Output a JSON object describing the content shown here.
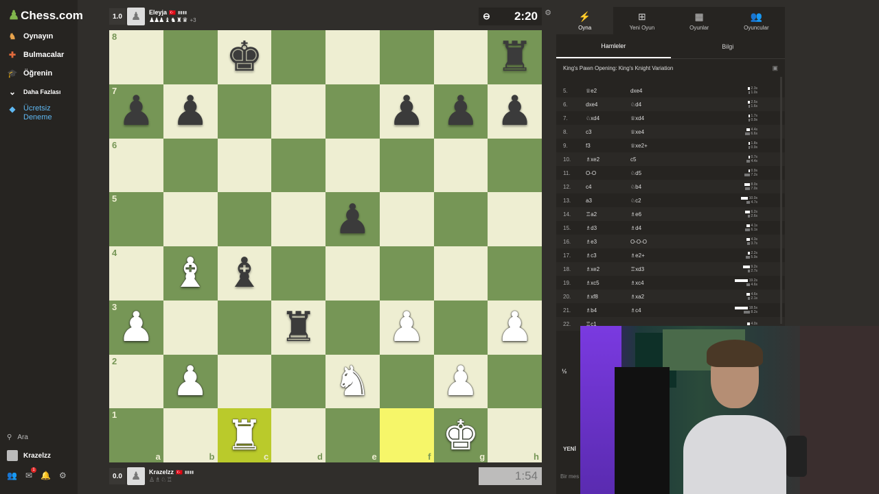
{
  "sidebar": {
    "logo": "Chess.com",
    "items": [
      {
        "label": "Oynayın",
        "icon": "play-icon"
      },
      {
        "label": "Bulmacalar",
        "icon": "puzzle-icon"
      },
      {
        "label": "Öğrenin",
        "icon": "learn-icon"
      },
      {
        "label": "Daha Fazlası",
        "icon": "chevron-down-icon"
      },
      {
        "label": "Ücretsiz Deneme",
        "icon": "diamond-icon"
      }
    ],
    "search": "Ara",
    "user": "Krazelzz",
    "notif_count": "1"
  },
  "top_player": {
    "rating": "1.0",
    "name": "Eleyja",
    "flag": "🇹🇷",
    "captured": "♟♟♟ ♝ ♞ ♜ ♛",
    "material": "+3",
    "clock": "2:20"
  },
  "bottom_player": {
    "rating": "0.0",
    "name": "Krazelzz",
    "flag": "🇹🇷",
    "captured": "♙ ♗ ♘ ♖",
    "clock": "1:54"
  },
  "board": {
    "files": [
      "a",
      "b",
      "c",
      "d",
      "e",
      "f",
      "g",
      "h"
    ],
    "ranks": [
      "8",
      "7",
      "6",
      "5",
      "4",
      "3",
      "2",
      "1"
    ],
    "position": [
      [
        "",
        "",
        "bK",
        "",
        "",
        "",
        "",
        "bR"
      ],
      [
        "bP",
        "bP",
        "",
        "",
        "",
        "bP",
        "bP",
        "bP"
      ],
      [
        "",
        "",
        "",
        "",
        "",
        "",
        "",
        ""
      ],
      [
        "",
        "",
        "",
        "",
        "bP",
        "",
        "",
        ""
      ],
      [
        "",
        "wB",
        "bB",
        "",
        "",
        "",
        "",
        ""
      ],
      [
        "wP",
        "",
        "",
        "bR",
        "",
        "wP",
        "",
        "wP"
      ],
      [
        "",
        "wP",
        "",
        "",
        "wN",
        "",
        "wP",
        ""
      ],
      [
        "",
        "",
        "wR",
        "",
        "",
        "",
        "wK",
        ""
      ]
    ],
    "highlight": [
      "c1",
      "f1"
    ]
  },
  "panel": {
    "tabs": [
      {
        "label": "Oyna",
        "icon": "lightning-icon"
      },
      {
        "label": "Yeni Oyun",
        "icon": "plus-square-icon"
      },
      {
        "label": "Oyunlar",
        "icon": "board-icon"
      },
      {
        "label": "Oyuncular",
        "icon": "players-icon"
      }
    ],
    "subtabs": [
      "Hamleler",
      "Bilgi"
    ],
    "opening": "King's Pawn Opening: King's Knight Variation",
    "moves": [
      {
        "n": "5.",
        "w": "♕e2",
        "b": "dxe4",
        "tw": "2.3s",
        "tb": "1.0s"
      },
      {
        "n": "6.",
        "w": "dxe4",
        "b": "♘d4",
        "tw": "2.5s",
        "tb": "1.6s"
      },
      {
        "n": "7.",
        "w": "♘xd4",
        "b": "♕xd4",
        "tw": "1.7s",
        "tb": "0.9s"
      },
      {
        "n": "8.",
        "w": "c3",
        "b": "♕xe4",
        "tw": "4.4s",
        "tb": "6.6s"
      },
      {
        "n": "9.",
        "w": "f3",
        "b": "♕xe2+",
        "tw": "1.8s",
        "tb": "0.9s"
      },
      {
        "n": "10.",
        "w": "♗xe2",
        "b": "c5",
        "tw": "0.7s",
        "tb": "4.4s"
      },
      {
        "n": "11.",
        "w": "O-O",
        "b": "♘d5",
        "tw": "0.9s",
        "tb": "7.2s"
      },
      {
        "n": "12.",
        "w": "c4",
        "b": "♘b4",
        "tw": "8.0s",
        "tb": "7.0s"
      },
      {
        "n": "13.",
        "w": "a3",
        "b": "♘c2",
        "tw": "10.0s",
        "tb": "4.7s"
      },
      {
        "n": "14.",
        "w": "♖a2",
        "b": "♗e6",
        "tw": "6.2s",
        "tb": "2.6s"
      },
      {
        "n": "15.",
        "w": "♗d3",
        "b": "♗d4",
        "tw": "4.1s",
        "tb": "6.1s"
      },
      {
        "n": "16.",
        "w": "♗e3",
        "b": "O-O-O",
        "tw": "4.3s",
        "tb": "3.7s"
      },
      {
        "n": "17.",
        "w": "♗c3",
        "b": "♗e2+",
        "tw": "2.2s",
        "tb": "5.9s"
      },
      {
        "n": "18.",
        "w": "♗xe2",
        "b": "♖xd3",
        "tw": "9.2s",
        "tb": "2.7s"
      },
      {
        "n": "19.",
        "w": "♗xc5",
        "b": "♗xc4",
        "tw": "19.2s",
        "tb": "4.6s"
      },
      {
        "n": "20.",
        "w": "♗xf8",
        "b": "♗xa2",
        "tw": "4.6s",
        "tb": "2.1s"
      },
      {
        "n": "21.",
        "w": "♗b4",
        "b": "♗c4",
        "tw": "18.5s",
        "tb": "8.2s"
      },
      {
        "n": "22.",
        "w": "♖c1",
        "b": "",
        "tw": "4.0s",
        "tb": ""
      }
    ],
    "message_placeholder": "Bir mes",
    "draw_label": "½",
    "new_label": "YENİ"
  }
}
